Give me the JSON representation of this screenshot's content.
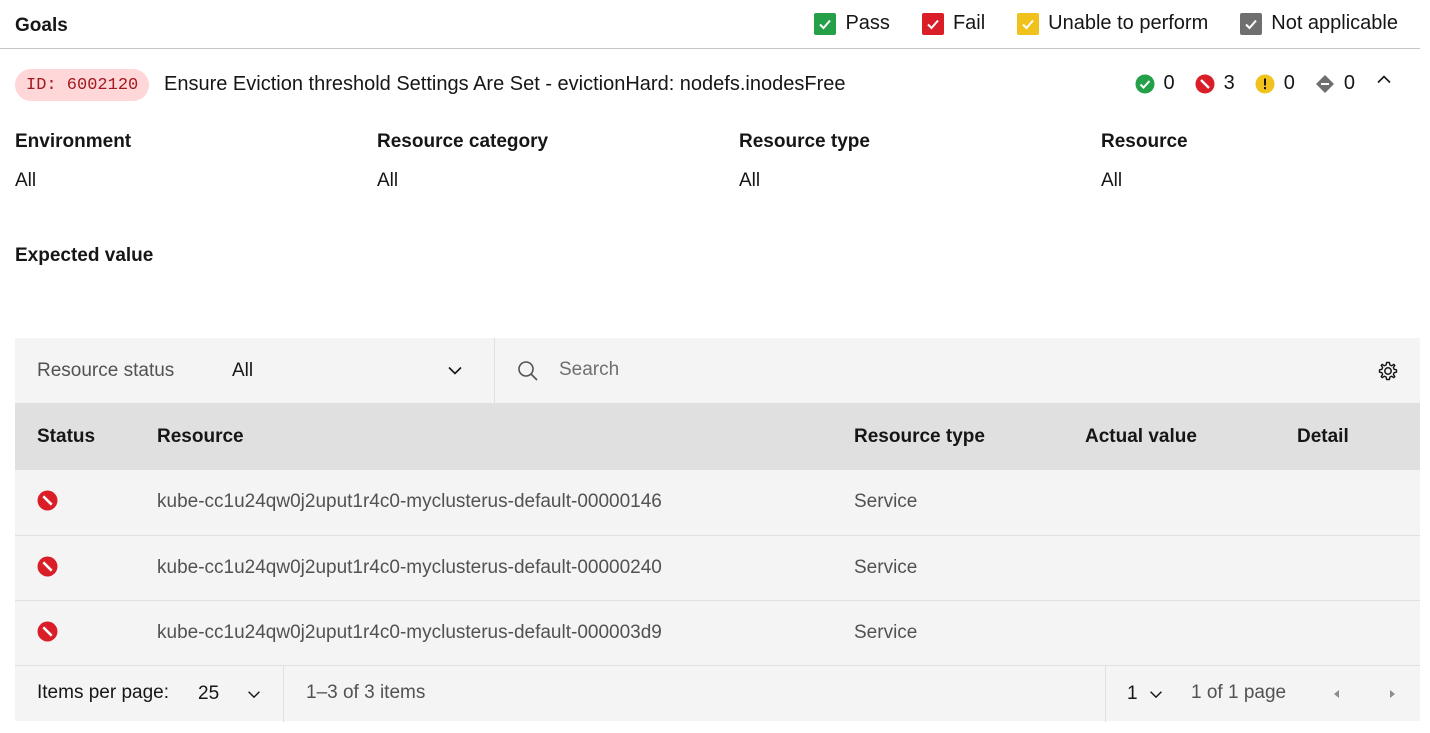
{
  "header": {
    "title": "Goals",
    "legend": [
      {
        "label": "Pass",
        "color": "#24a148",
        "icon": "checkbox-checked-icon"
      },
      {
        "label": "Fail",
        "color": "#da1e28",
        "icon": "checkbox-checked-icon"
      },
      {
        "label": "Unable to perform",
        "color": "#f1c21b",
        "icon": "checkbox-checked-icon"
      },
      {
        "label": "Not applicable",
        "color": "#6f6f6f",
        "icon": "checkbox-checked-icon"
      }
    ]
  },
  "goal": {
    "id_tag": "ID: 6002120",
    "title": "Ensure Eviction threshold Settings Are Set - evictionHard: nodefs.inodesFree",
    "counts": {
      "pass": "0",
      "fail": "3",
      "unable": "0",
      "not_applicable": "0"
    }
  },
  "meta": [
    {
      "label": "Environment",
      "value": "All"
    },
    {
      "label": "Resource category",
      "value": "All"
    },
    {
      "label": "Resource type",
      "value": "All"
    },
    {
      "label": "Resource",
      "value": "All"
    }
  ],
  "expected_value_label": "Expected value",
  "toolbar": {
    "filter_label": "Resource status",
    "filter_value": "All",
    "search_placeholder": "Search"
  },
  "table": {
    "headers": {
      "status": "Status",
      "resource": "Resource",
      "resource_type": "Resource type",
      "actual_value": "Actual value",
      "detail": "Detail"
    },
    "rows": [
      {
        "status": "fail",
        "resource": "kube-cc1u24qw0j2uput1r4c0-myclusterus-default-00000146",
        "resource_type": "Service",
        "actual_value": "",
        "detail": ""
      },
      {
        "status": "fail",
        "resource": "kube-cc1u24qw0j2uput1r4c0-myclusterus-default-00000240",
        "resource_type": "Service",
        "actual_value": "",
        "detail": ""
      },
      {
        "status": "fail",
        "resource": "kube-cc1u24qw0j2uput1r4c0-myclusterus-default-000003d9",
        "resource_type": "Service",
        "actual_value": "",
        "detail": ""
      }
    ]
  },
  "pagination": {
    "items_per_page_label": "Items per page:",
    "items_per_page": "25",
    "range": "1–3 of 3 items",
    "page": "1",
    "page_of": "1 of 1 page"
  },
  "colors": {
    "pass": "#24a148",
    "fail": "#da1e28",
    "warning": "#f1c21b",
    "neutral": "#6f6f6f",
    "id_tag_bg": "#ffd7d9"
  }
}
